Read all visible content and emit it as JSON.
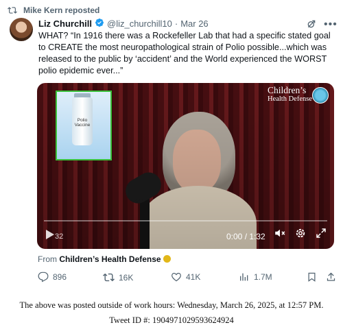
{
  "repost": {
    "text": "Mike Kern reposted"
  },
  "author": {
    "name": "Liz Churchill",
    "handle": "@liz_churchill10",
    "separator": "·",
    "date": "Mar 26"
  },
  "tweet": {
    "text": "WHAT? “In 1916 there was a Rockefeller Lab that had a specific stated goal to CREATE the most neuropathological strain of Polio possible...which was released to the public by ‘accident’ and the World experienced the WORST polio epidemic ever...”"
  },
  "video": {
    "overlay_logo_line1": "Children’s",
    "overlay_logo_line2": "Health Defense",
    "inset_label": "Polio Vaccine",
    "time_left": "32",
    "time": "0:00 / 1:32",
    "progress_fraction": 0.0
  },
  "source": {
    "prefix": "From",
    "name": "Children’s Health Defense"
  },
  "actions": {
    "replies": "896",
    "reposts": "16K",
    "likes": "41K",
    "views": "1.7M"
  },
  "footer": {
    "line1": "The above was posted outside of work hours: Wednesday, March 26, 2025, at 12:57 PM.",
    "line2": "Tweet ID #: 1904971029593624924"
  },
  "colors": {
    "verified": "#1d9bf0",
    "muted": "#536471",
    "accent_green": "#3ac13a"
  }
}
